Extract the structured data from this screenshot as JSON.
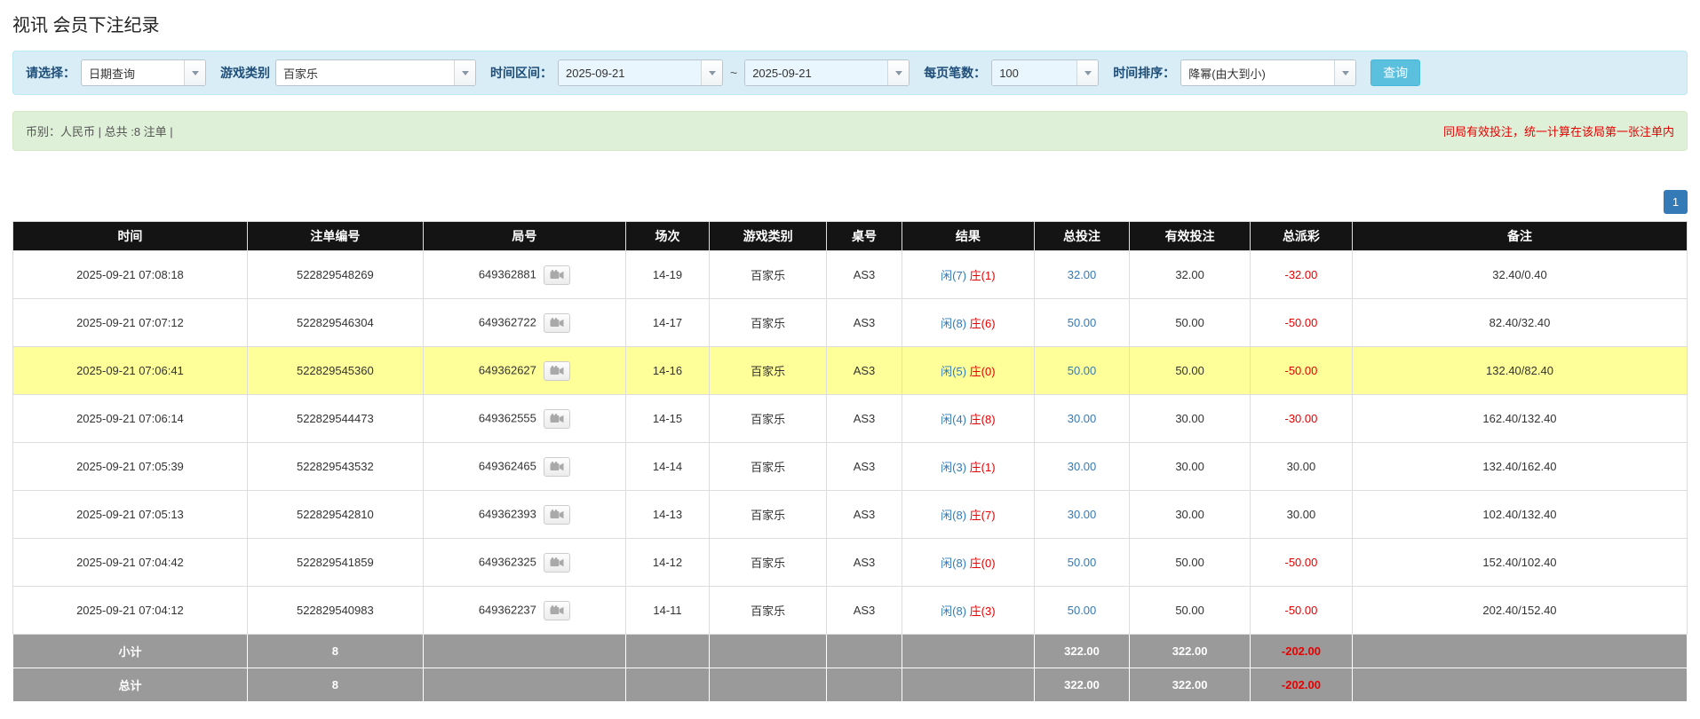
{
  "page": {
    "title": "视讯 会员下注纪录"
  },
  "colors": {
    "accent_blue": "#337ab7",
    "negative_red": "#e60000",
    "highlight_yellow": "#ffff99",
    "header_bg": "#141414",
    "footer_bg": "#9a9a9a",
    "filter_bg": "#d9edf7",
    "info_bg": "#dff0d8",
    "search_btn": "#5bc0de"
  },
  "filters": {
    "select_label": "请选择：",
    "select_value": "日期查询",
    "game_type_label": "游戏类别",
    "game_type_value": "百家乐",
    "time_range_label": "时间区间：",
    "date_from": "2025-09-21",
    "date_separator": "~",
    "date_to": "2025-09-21",
    "page_size_label": "每页笔数：",
    "page_size_value": "100",
    "sort_label": "时间排序：",
    "sort_value": "降幂(由大到小)",
    "search_button": "查询"
  },
  "summary": {
    "left": "币别：人民币 | 总共 :8 注单 |",
    "right": "同局有效投注，统一计算在该局第一张注单内"
  },
  "pagination": {
    "current": "1"
  },
  "table": {
    "headers": [
      "时间",
      "注单编号",
      "局号",
      "场次",
      "游戏类别",
      "桌号",
      "结果",
      "总投注",
      "有效投注",
      "总派彩",
      "备注"
    ],
    "rows": [
      {
        "time": "2025-09-21 07:08:18",
        "bet_id": "522829548269",
        "round_id": "649362881",
        "session": "14-19",
        "game": "百家乐",
        "table_no": "AS3",
        "result_player": "闲(7)",
        "result_banker": "庄(1)",
        "total_bet": "32.00",
        "valid_bet": "32.00",
        "payout": "-32.00",
        "remark": "32.40/0.40",
        "highlight": false
      },
      {
        "time": "2025-09-21 07:07:12",
        "bet_id": "522829546304",
        "round_id": "649362722",
        "session": "14-17",
        "game": "百家乐",
        "table_no": "AS3",
        "result_player": "闲(8)",
        "result_banker": "庄(6)",
        "total_bet": "50.00",
        "valid_bet": "50.00",
        "payout": "-50.00",
        "remark": "82.40/32.40",
        "highlight": false
      },
      {
        "time": "2025-09-21 07:06:41",
        "bet_id": "522829545360",
        "round_id": "649362627",
        "session": "14-16",
        "game": "百家乐",
        "table_no": "AS3",
        "result_player": "闲(5)",
        "result_banker": "庄(0)",
        "total_bet": "50.00",
        "valid_bet": "50.00",
        "payout": "-50.00",
        "remark": "132.40/82.40",
        "highlight": true
      },
      {
        "time": "2025-09-21 07:06:14",
        "bet_id": "522829544473",
        "round_id": "649362555",
        "session": "14-15",
        "game": "百家乐",
        "table_no": "AS3",
        "result_player": "闲(4)",
        "result_banker": "庄(8)",
        "total_bet": "30.00",
        "valid_bet": "30.00",
        "payout": "-30.00",
        "remark": "162.40/132.40",
        "highlight": false
      },
      {
        "time": "2025-09-21 07:05:39",
        "bet_id": "522829543532",
        "round_id": "649362465",
        "session": "14-14",
        "game": "百家乐",
        "table_no": "AS3",
        "result_player": "闲(3)",
        "result_banker": "庄(1)",
        "total_bet": "30.00",
        "valid_bet": "30.00",
        "payout": "30.00",
        "remark": "132.40/162.40",
        "highlight": false
      },
      {
        "time": "2025-09-21 07:05:13",
        "bet_id": "522829542810",
        "round_id": "649362393",
        "session": "14-13",
        "game": "百家乐",
        "table_no": "AS3",
        "result_player": "闲(8)",
        "result_banker": "庄(7)",
        "total_bet": "30.00",
        "valid_bet": "30.00",
        "payout": "30.00",
        "remark": "102.40/132.40",
        "highlight": false
      },
      {
        "time": "2025-09-21 07:04:42",
        "bet_id": "522829541859",
        "round_id": "649362325",
        "session": "14-12",
        "game": "百家乐",
        "table_no": "AS3",
        "result_player": "闲(8)",
        "result_banker": "庄(0)",
        "total_bet": "50.00",
        "valid_bet": "50.00",
        "payout": "-50.00",
        "remark": "152.40/102.40",
        "highlight": false
      },
      {
        "time": "2025-09-21 07:04:12",
        "bet_id": "522829540983",
        "round_id": "649362237",
        "session": "14-11",
        "game": "百家乐",
        "table_no": "AS3",
        "result_player": "闲(8)",
        "result_banker": "庄(3)",
        "total_bet": "50.00",
        "valid_bet": "50.00",
        "payout": "-50.00",
        "remark": "202.40/152.40",
        "highlight": false
      }
    ],
    "subtotal": {
      "label": "小计",
      "count": "8",
      "total_bet": "322.00",
      "valid_bet": "322.00",
      "payout": "-202.00"
    },
    "total": {
      "label": "总计",
      "count": "8",
      "total_bet": "322.00",
      "valid_bet": "322.00",
      "payout": "-202.00"
    }
  }
}
